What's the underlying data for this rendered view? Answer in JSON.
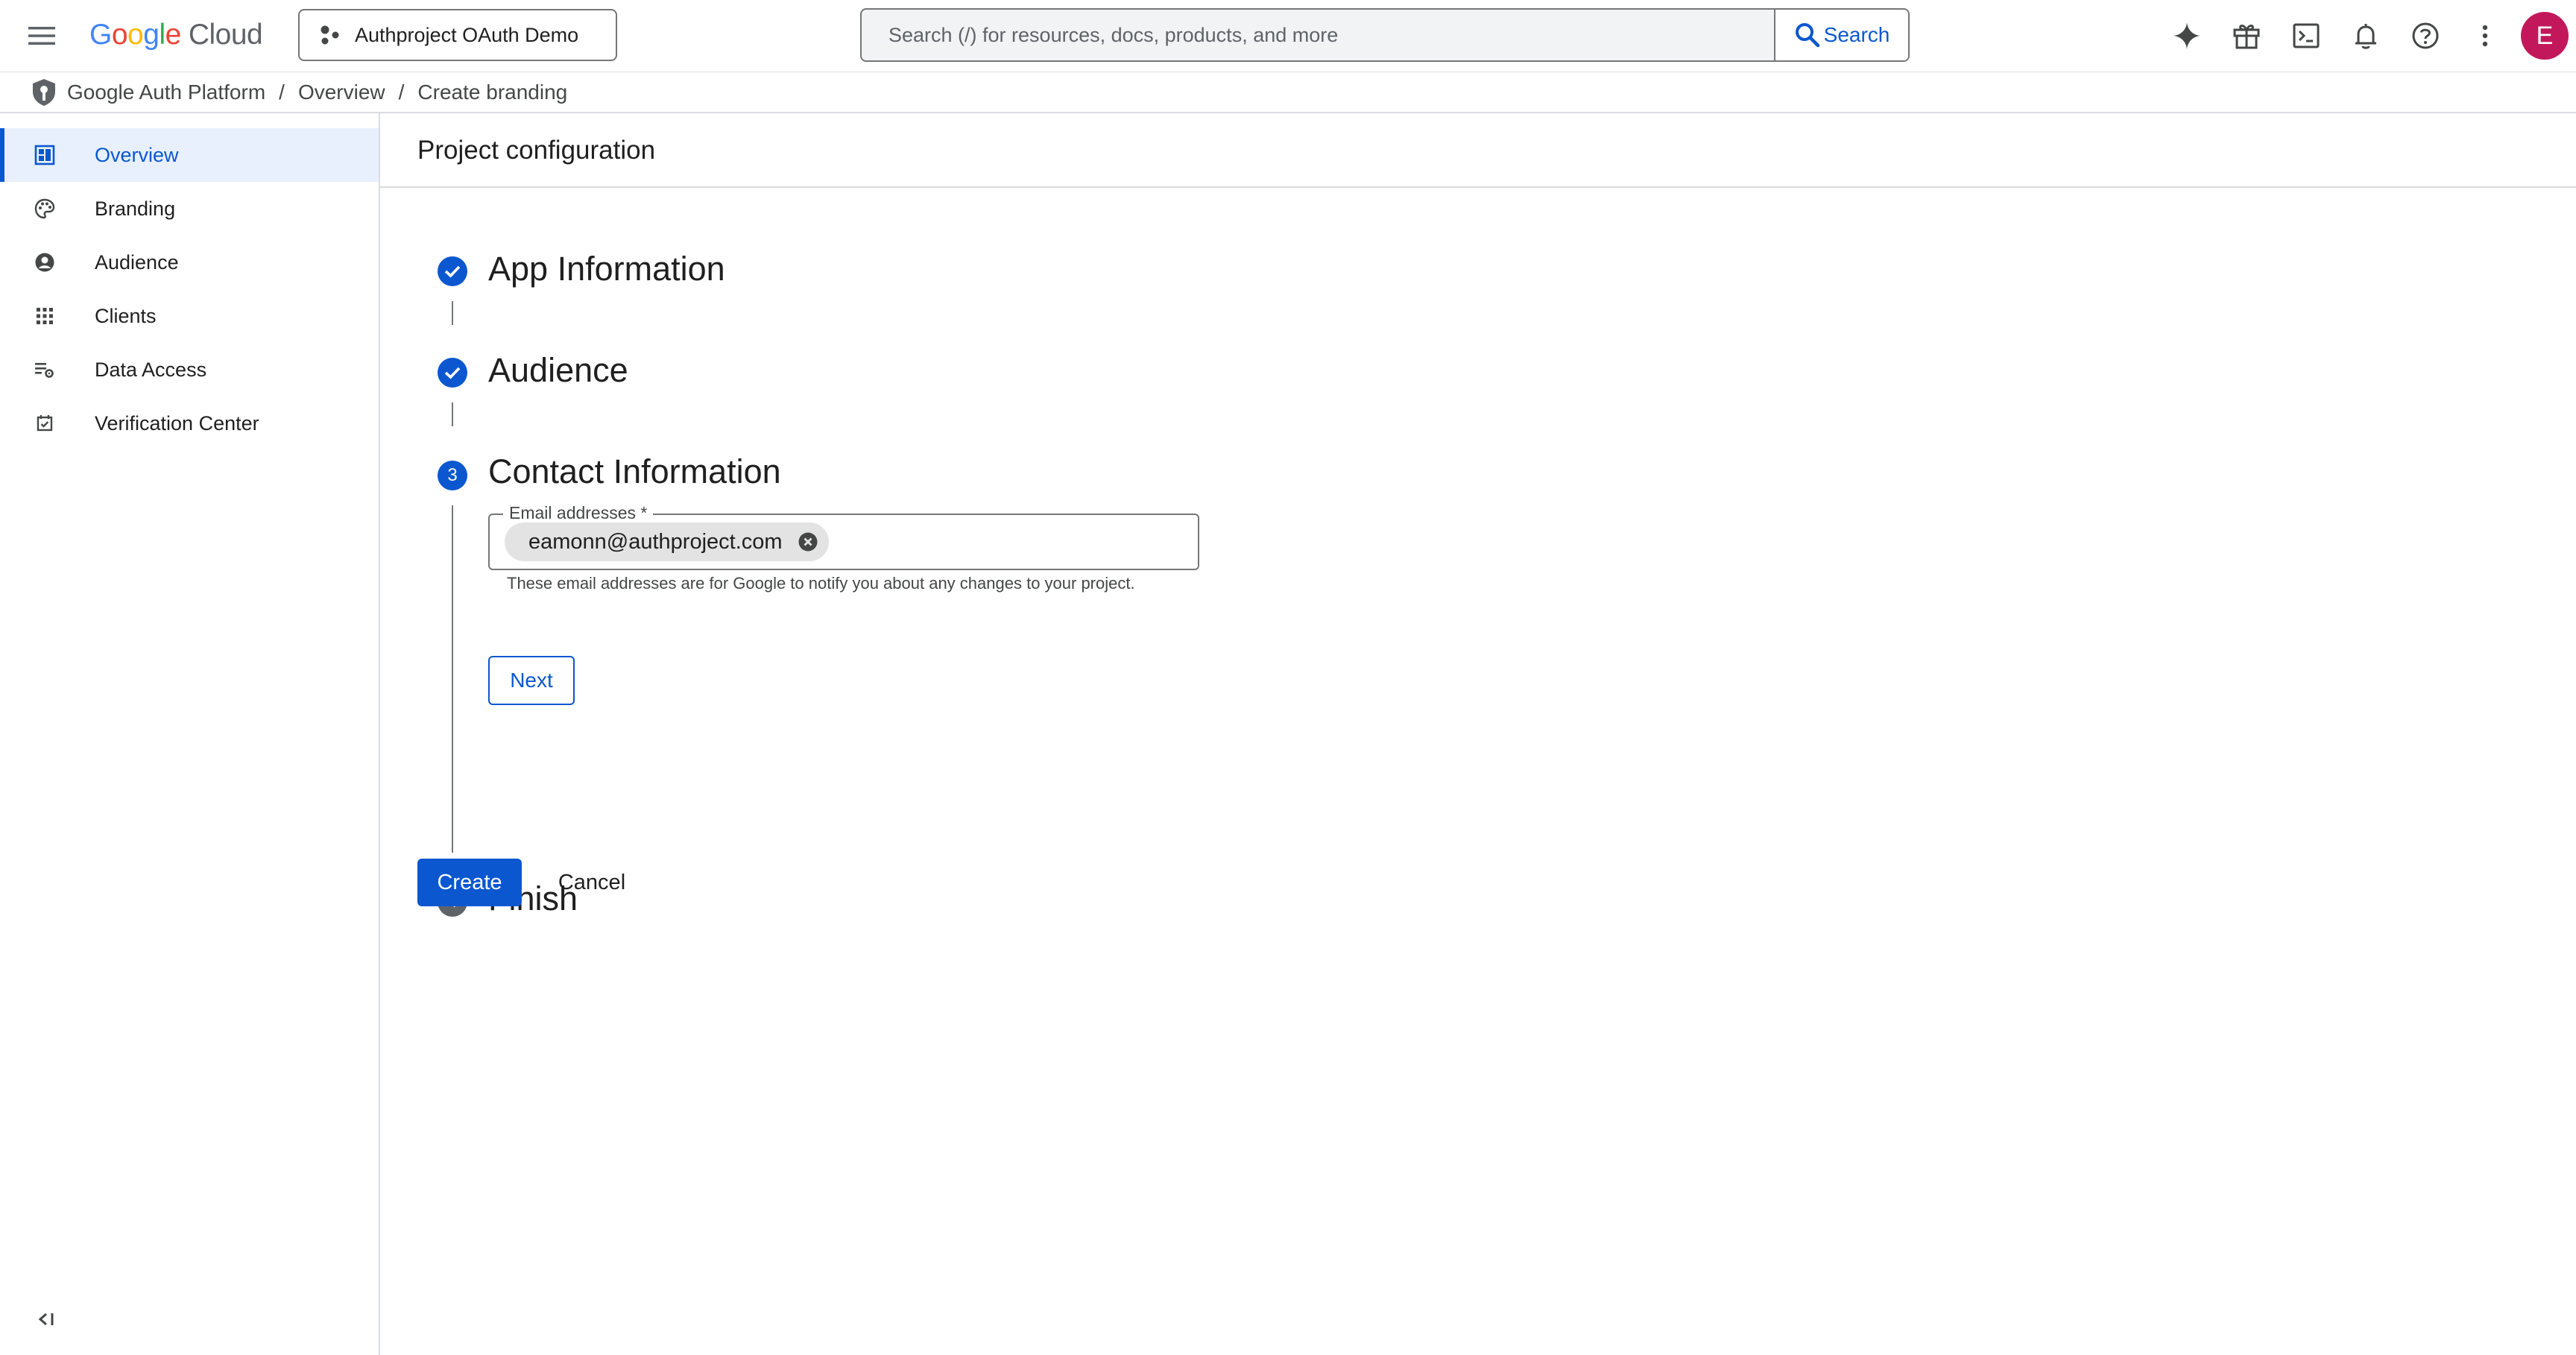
{
  "header": {
    "logo_parts": [
      {
        "text": "G",
        "color": "#4285F4"
      },
      {
        "text": "o",
        "color": "#EA4335"
      },
      {
        "text": "o",
        "color": "#FBBC04"
      },
      {
        "text": "g",
        "color": "#4285F4"
      },
      {
        "text": "l",
        "color": "#34A853"
      },
      {
        "text": "e",
        "color": "#EA4335"
      }
    ],
    "logo_suffix": "Cloud",
    "project_name": "Authproject OAuth Demo",
    "search_placeholder": "Search (/) for resources, docs, products, and more",
    "search_button": "Search",
    "icons": [
      "gemini-icon",
      "gift-icon",
      "cloud-shell-icon",
      "notifications-icon",
      "help-icon",
      "more-vert-icon"
    ],
    "avatar_letter": "E",
    "avatar_color": "#C2185B"
  },
  "breadcrumb": {
    "items": [
      "Google Auth Platform",
      "Overview",
      "Create branding"
    ],
    "separator": "/"
  },
  "sidebar": {
    "items": [
      {
        "label": "Overview",
        "icon": "dashboard-icon",
        "active": true
      },
      {
        "label": "Branding",
        "icon": "palette-icon",
        "active": false
      },
      {
        "label": "Audience",
        "icon": "account-circle-icon",
        "active": false
      },
      {
        "label": "Clients",
        "icon": "apps-grid-icon",
        "active": false
      },
      {
        "label": "Data Access",
        "icon": "data-access-icon",
        "active": false
      },
      {
        "label": "Verification Center",
        "icon": "verification-icon",
        "active": false
      }
    ],
    "collapse_glyph": "<I"
  },
  "main": {
    "page_title": "Project configuration",
    "steps": [
      {
        "title": "App Information",
        "state": "completed"
      },
      {
        "title": "Audience",
        "state": "completed"
      },
      {
        "title": "Contact Information",
        "state": "current",
        "number": "3"
      },
      {
        "title": "Finish",
        "state": "pending",
        "number": "4"
      }
    ],
    "email_field": {
      "label": "Email addresses *",
      "chips": [
        "eamonn@authproject.com"
      ],
      "helper_text": "These email addresses are for Google to notify you about any changes to your project."
    },
    "next_button": "Next",
    "create_button": "Create",
    "cancel_button": "Cancel"
  },
  "colors": {
    "primary": "#0B57D0",
    "active_nav_bg": "#E8F0FE",
    "border": "#747775",
    "divider": "#DADCE0"
  }
}
